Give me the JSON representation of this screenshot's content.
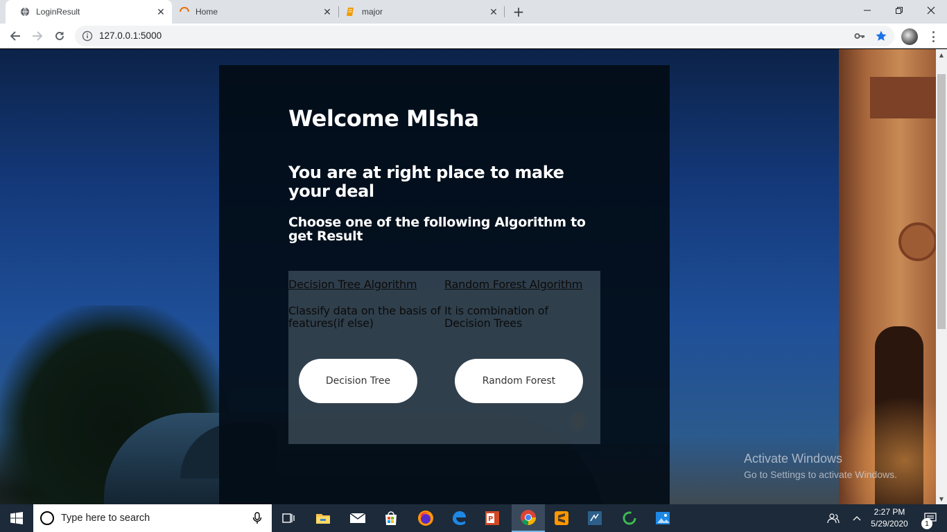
{
  "browser": {
    "tabs": [
      {
        "title": "LoginResult",
        "icon": "globe-icon",
        "active": true
      },
      {
        "title": "Home",
        "icon": "loading-spinner-icon",
        "active": false
      },
      {
        "title": "major",
        "icon": "document-icon",
        "active": false
      }
    ],
    "url": "127.0.0.1:5000",
    "accent_color": "#1a73e8"
  },
  "page": {
    "welcome": "Welcome MIsha",
    "subtitle": "You are at right place to make your deal",
    "choose": "Choose one of the following Algorithm to get Result",
    "panel_color": "#020c16",
    "algorithms": [
      {
        "link": "Decision Tree Algorithm",
        "description": "Classify data on the basis of features(if else)",
        "button": "Decision Tree"
      },
      {
        "link": "Random Forest Algorithm",
        "description": "It is combination of Decision Trees",
        "button": "Random Forest"
      }
    ],
    "watermark_title": "Activate Windows",
    "watermark_sub": "Go to Settings to activate Windows."
  },
  "taskbar": {
    "search_placeholder": "Type here to search",
    "apps": [
      "task-view-icon",
      "file-explorer-icon",
      "mail-icon",
      "store-icon",
      "firefox-icon",
      "edge-icon",
      "powerpoint-icon",
      "chrome-icon",
      "sublime-text-icon",
      "vscode-icon",
      "circle-app-icon",
      "photos-icon"
    ],
    "time": "2:27 PM",
    "date": "5/29/2020",
    "notification_count": "1",
    "color": "#1c2a3a"
  }
}
